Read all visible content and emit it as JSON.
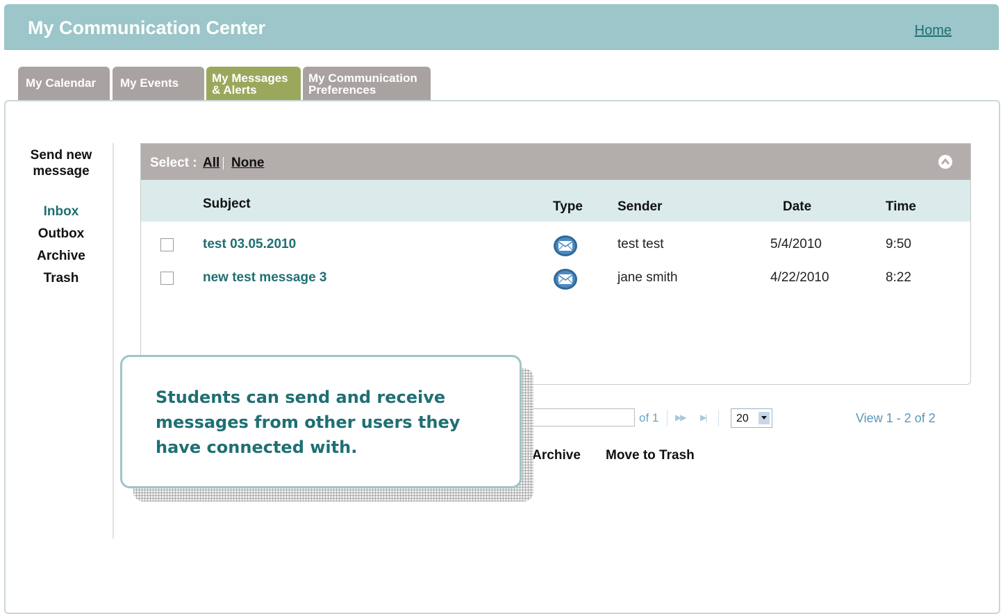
{
  "app": {
    "title": "My Communication Center",
    "home_link": "Home"
  },
  "tabs": [
    {
      "label": "My Calendar",
      "active": false
    },
    {
      "label": "My Events",
      "active": false
    },
    {
      "label_line1": "My Messages",
      "label_line2": "& Alerts",
      "active": true
    },
    {
      "label_line1": "My Communication",
      "label_line2": "Preferences",
      "active": false
    }
  ],
  "sidebar": {
    "send_new_line1": "Send new",
    "send_new_line2": "message",
    "folders": [
      "Inbox",
      "Outbox",
      "Archive",
      "Trash"
    ],
    "active_folder": "Inbox"
  },
  "select_bar": {
    "label": "Select :",
    "all": "All",
    "none": "None"
  },
  "columns": {
    "subject": "Subject",
    "type": "Type",
    "sender": "Sender",
    "date": "Date",
    "time": "Time"
  },
  "messages": [
    {
      "subject": "test 03.05.2010",
      "type_icon": "envelope-icon",
      "sender": "test test",
      "date": "5/4/2010",
      "time": "9:50"
    },
    {
      "subject": "new test message 3",
      "type_icon": "envelope-icon",
      "sender": "jane smith",
      "date": "4/22/2010",
      "time": "8:22"
    }
  ],
  "pager": {
    "of_text": "of 1",
    "page_size": "20",
    "view_text": "View 1 - 2 of 2"
  },
  "actions": {
    "archive_visible_text": "o Archive",
    "trash": "Move to Trash"
  },
  "callout": {
    "text": "Students can send and receive messages from other users they have connected with."
  },
  "colors": {
    "header": "#9cc6c9",
    "active_tab": "#9ba85c",
    "inactive_tab": "#a8a3a0",
    "link_teal": "#1f6f73",
    "select_bar": "#b3aeab",
    "column_header_bg": "#dbebec"
  }
}
